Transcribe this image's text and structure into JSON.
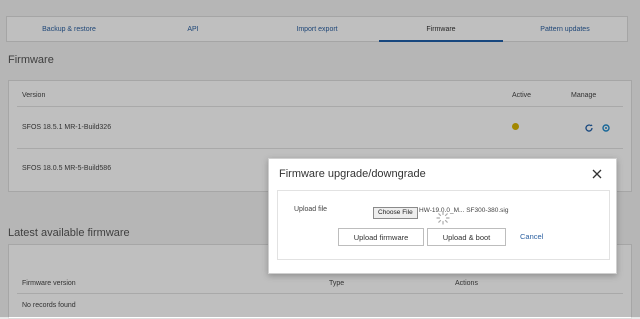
{
  "tabs": [
    {
      "label": "Backup & restore"
    },
    {
      "label": "API"
    },
    {
      "label": "Import export"
    },
    {
      "label": "Firmware"
    },
    {
      "label": "Pattern updates"
    }
  ],
  "firmware": {
    "title": "Firmware",
    "headers": {
      "version": "Version",
      "active": "Active",
      "manage": "Manage"
    },
    "rows": [
      {
        "version": "SFOS 18.5.1 MR-1-Build326"
      },
      {
        "version": "SFOS 18.0.5 MR-5-Build586"
      }
    ]
  },
  "latest": {
    "title": "Latest available firmware",
    "headers": {
      "version": "Firmware version",
      "type": "Type",
      "actions": "Actions"
    },
    "empty": "No records found"
  },
  "modal": {
    "title": "Firmware upgrade/downgrade",
    "upload_label": "Upload file",
    "choose_file": "Choose File",
    "file_name": "HW-19.0.0_M... SF300-380.sig",
    "upload_firmware": "Upload firmware",
    "upload_boot": "Upload & boot",
    "cancel": "Cancel"
  },
  "colors": {
    "accent": "#1f5fa8",
    "active_dot": "#d9b400",
    "link": "#2a5fa0"
  }
}
